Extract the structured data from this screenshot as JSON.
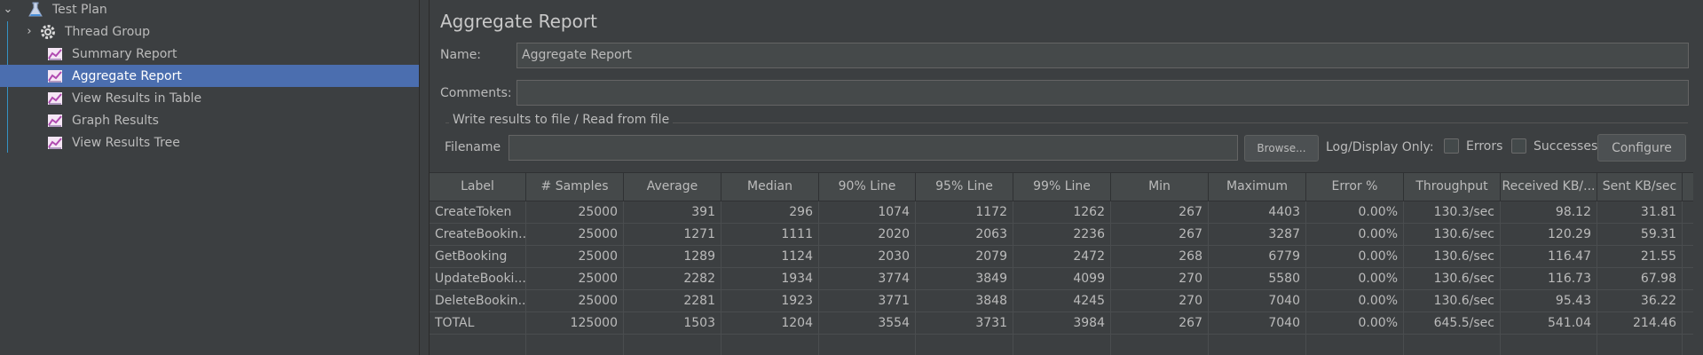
{
  "tree": {
    "items": [
      {
        "label": "Test Plan"
      },
      {
        "label": "Thread Group"
      },
      {
        "label": "Summary Report"
      },
      {
        "label": "Aggregate Report"
      },
      {
        "label": "View Results in Table"
      },
      {
        "label": "Graph Results"
      },
      {
        "label": "View Results Tree"
      }
    ],
    "selected": "Aggregate Report"
  },
  "panel": {
    "title": "Aggregate Report",
    "name_label": "Name:",
    "name_value": "Aggregate Report",
    "comments_label": "Comments:",
    "comments_value": "",
    "file_section_title": "Write results to file / Read from file",
    "filename_label": "Filename",
    "filename_value": "",
    "browse_label": "Browse...",
    "log_display_label": "Log/Display Only:",
    "errors_label": "Errors",
    "successes_label": "Successes",
    "configure_label": "Configure"
  },
  "table": {
    "columns": [
      "Label",
      "# Samples",
      "Average",
      "Median",
      "90% Line",
      "95% Line",
      "99% Line",
      "Min",
      "Maximum",
      "Error %",
      "Throughput",
      "Received KB/...",
      "Sent KB/sec"
    ],
    "rows": [
      [
        "CreateToken",
        "25000",
        "391",
        "296",
        "1074",
        "1172",
        "1262",
        "267",
        "4403",
        "0.00%",
        "130.3/sec",
        "98.12",
        "31.81"
      ],
      [
        "CreateBookin...",
        "25000",
        "1271",
        "1111",
        "2020",
        "2063",
        "2236",
        "267",
        "3287",
        "0.00%",
        "130.6/sec",
        "120.29",
        "59.31"
      ],
      [
        "GetBooking",
        "25000",
        "1289",
        "1124",
        "2030",
        "2079",
        "2472",
        "268",
        "6779",
        "0.00%",
        "130.6/sec",
        "116.47",
        "21.55"
      ],
      [
        "UpdateBooki...",
        "25000",
        "2282",
        "1934",
        "3774",
        "3849",
        "4099",
        "270",
        "5580",
        "0.00%",
        "130.6/sec",
        "116.73",
        "67.98"
      ],
      [
        "DeleteBookin...",
        "25000",
        "2281",
        "1923",
        "3771",
        "3848",
        "4245",
        "270",
        "7040",
        "0.00%",
        "130.6/sec",
        "95.43",
        "36.22"
      ],
      [
        "TOTAL",
        "125000",
        "1503",
        "1204",
        "3554",
        "3731",
        "3984",
        "267",
        "7040",
        "0.00%",
        "645.5/sec",
        "541.04",
        "214.46"
      ]
    ]
  }
}
